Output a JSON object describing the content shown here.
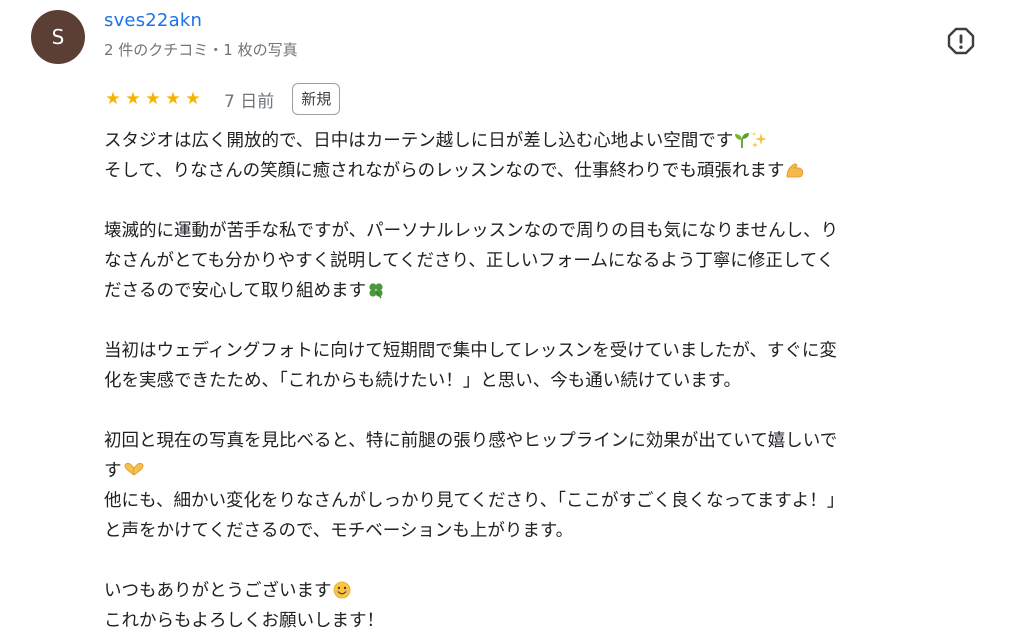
{
  "author": {
    "avatar_letter": "S",
    "name": "sves22akn",
    "meta": "2 件のクチコミ・1 枚の写真"
  },
  "report_icon": "alert-octagon-icon",
  "rating": {
    "stars": 5,
    "date": "7 日前",
    "badge": "新規"
  },
  "review_lines": [
    [
      "スタジオは広く開放的で、日中はカーテン越しに日が差し込む心地よい空間です",
      "そして、りなさんの笑顔に癒されながらのレッスンなので、仕事終わりでも頑張れます"
    ],
    [
      "壊滅的に運動が苦手な私ですが、パーソナルレッスンなので周りの目も気になりませんし、り",
      "なさんがとても分かりやすく説明してくださり、正しいフォームになるよう丁寧に修正してく",
      "ださるので安心して取り組めます"
    ],
    [
      "当初はウェディングフォトに向けて短期間で集中してレッスンを受けていましたが、すぐに変",
      "化を実感できたため、「これからも続けたい！」と思い、今も通い続けています。"
    ],
    [
      "初回と現在の写真を見比べると、特に前腿の張り感やヒップラインに効果が出ていて嬉しいで",
      "す",
      "他にも、細かい変化をりなさんがしっかり見てくださり、「ここがすごく良くなってますよ！」",
      "と声をかけてくださるので、モチベーションも上がります。"
    ],
    [
      "いつもありがとうございます",
      "これからもよろしくお願いします！"
    ]
  ],
  "emoji_icons": {
    "seedling": "seedling-icon",
    "sparkles": "sparkles-icon",
    "muscle": "flexed-biceps-icon",
    "clover": "four-leaf-clover-icon",
    "heart_hands": "heart-hands-icon",
    "smile": "smiling-face-icon"
  },
  "colors": {
    "author_name": "#1a73e8",
    "star": "#f4b400",
    "avatar_bg": "#5b3e34"
  }
}
